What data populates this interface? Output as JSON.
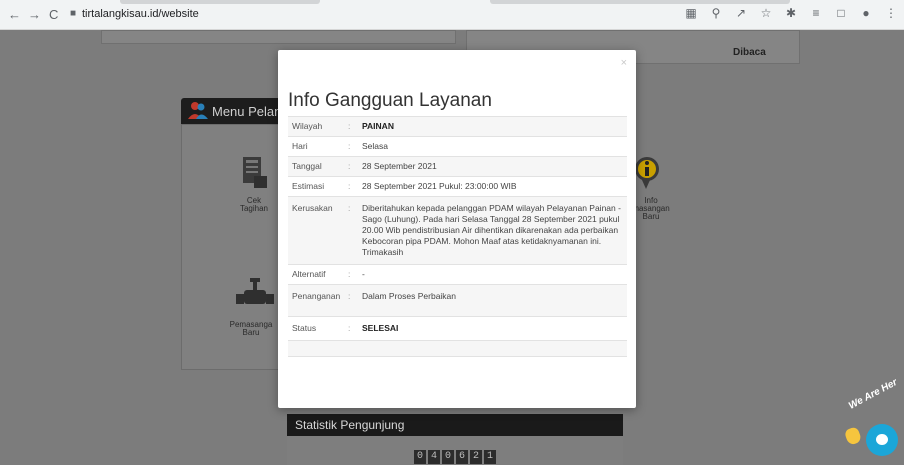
{
  "browser": {
    "url": "tirtalangkisau.id/website",
    "back_icon": "←",
    "forward_icon": "→",
    "reload_icon": "C",
    "lock_icon": "🔒"
  },
  "background": {
    "dibaca": "Dibaca",
    "menu_title": "Menu Pelan",
    "items": {
      "cek_tagihan": "Cek Tagihan",
      "info_pemasangan": "Info masangan Baru",
      "pemasangan_baru": "Pemasanga Baru"
    },
    "statistik_title": "Statistik Pengunjung",
    "counter_digits": [
      "0",
      "4",
      "0",
      "6",
      "2",
      "1"
    ]
  },
  "modal": {
    "close": "×",
    "title": "Info Gangguan Layanan",
    "separator": ":",
    "rows": [
      {
        "label": "Wilayah",
        "value": "PAINAN"
      },
      {
        "label": "Hari",
        "value": "Selasa"
      },
      {
        "label": "Tanggal",
        "value": "28 September 2021"
      },
      {
        "label": "Estimasi",
        "value": "28 September 2021 Pukul: 23:00:00 WIB"
      },
      {
        "label": "Kerusakan",
        "value": "Diberitahukan kepada pelanggan PDAM wilayah Pelayanan Painan - Sago (Luhung). Pada hari Selasa Tanggal 28 September 2021 pukul 20.00 Wib pendistribusian Air dihentikan dikarenakan ada perbaikan Kebocoran pipa PDAM. Mohon Maaf atas ketidaknyamanan ini. Trimakasih"
      },
      {
        "label": "Alternatif",
        "value": "-"
      },
      {
        "label": "Penanganan",
        "value": "Dalam Proses Perbaikan"
      },
      {
        "label": "Status",
        "value": "SELESAI"
      }
    ]
  },
  "chat": {
    "label": "We Are Her"
  }
}
